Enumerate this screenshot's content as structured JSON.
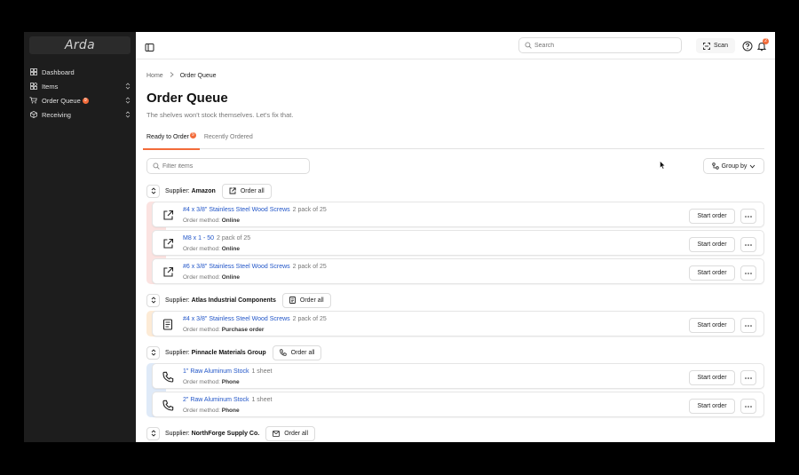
{
  "app": {
    "logo": "Arda"
  },
  "sidebar": {
    "items": [
      {
        "label": "Dashboard",
        "icon": "dashboard-icon",
        "has_chevron": false
      },
      {
        "label": "Items",
        "icon": "items-icon",
        "has_chevron": true
      },
      {
        "label": "Order Queue",
        "icon": "cart-icon",
        "has_chevron": true,
        "badge": "9"
      },
      {
        "label": "Receiving",
        "icon": "box-icon",
        "has_chevron": true
      }
    ]
  },
  "topbar": {
    "search_placeholder": "Search",
    "scan_label": "Scan",
    "notification_count": "2"
  },
  "breadcrumb": {
    "home": "Home",
    "current": "Order Queue"
  },
  "page": {
    "title": "Order Queue",
    "subtitle": "The shelves won't stock themselves. Let's fix that."
  },
  "tabs": [
    {
      "label": "Ready to Order",
      "badge": "9",
      "active": true
    },
    {
      "label": "Recently Ordered",
      "active": false
    }
  ],
  "filter": {
    "placeholder": "Filter items"
  },
  "group_by_label": "Group by",
  "colors": {
    "accent": "#f26b3a",
    "link": "#2256c8",
    "amazon_bar": "#fbe3e1",
    "atlas_bar": "#fdebd6",
    "pinnacle_bar": "#dfeaf8"
  },
  "groups": [
    {
      "supplier_prefix": "Supplier:",
      "supplier": "Amazon",
      "order_all_label": "Order all",
      "items": [
        {
          "name": "#4 x 3/8\" Stainless Steel Wood Screws",
          "qty": "2 pack of 25",
          "method_label": "Order method:",
          "method": "Online",
          "start_label": "Start order"
        },
        {
          "name": "M8 x 1 - 50",
          "qty": "2 pack of 25",
          "method_label": "Order method:",
          "method": "Online",
          "start_label": "Start order"
        },
        {
          "name": "#6 x 3/8\" Stainless Steel Wood Screws",
          "qty": "2 pack of 25",
          "method_label": "Order method:",
          "method": "Online",
          "start_label": "Start order"
        }
      ]
    },
    {
      "supplier_prefix": "Supplier:",
      "supplier": "Atlas Industrial Components",
      "order_all_label": "Order all",
      "items": [
        {
          "name": "#4 x 3/8\" Stainless Steel Wood Screws",
          "qty": "2 pack of 25",
          "method_label": "Order method:",
          "method": "Purchase order",
          "start_label": "Start order"
        }
      ]
    },
    {
      "supplier_prefix": "Supplier:",
      "supplier": "Pinnacle Materials Group",
      "order_all_label": "Order all",
      "items": [
        {
          "name": "1\" Raw Aluminum Stock",
          "qty": "1 sheet",
          "method_label": "Order method:",
          "method": "Phone",
          "start_label": "Start order"
        },
        {
          "name": "2\" Raw Aluminum Stock",
          "qty": "1 sheet",
          "method_label": "Order method:",
          "method": "Phone",
          "start_label": "Start order"
        }
      ]
    },
    {
      "supplier_prefix": "Supplier:",
      "supplier": "NorthForge Supply Co.",
      "order_all_label": "Order all",
      "items": []
    }
  ]
}
